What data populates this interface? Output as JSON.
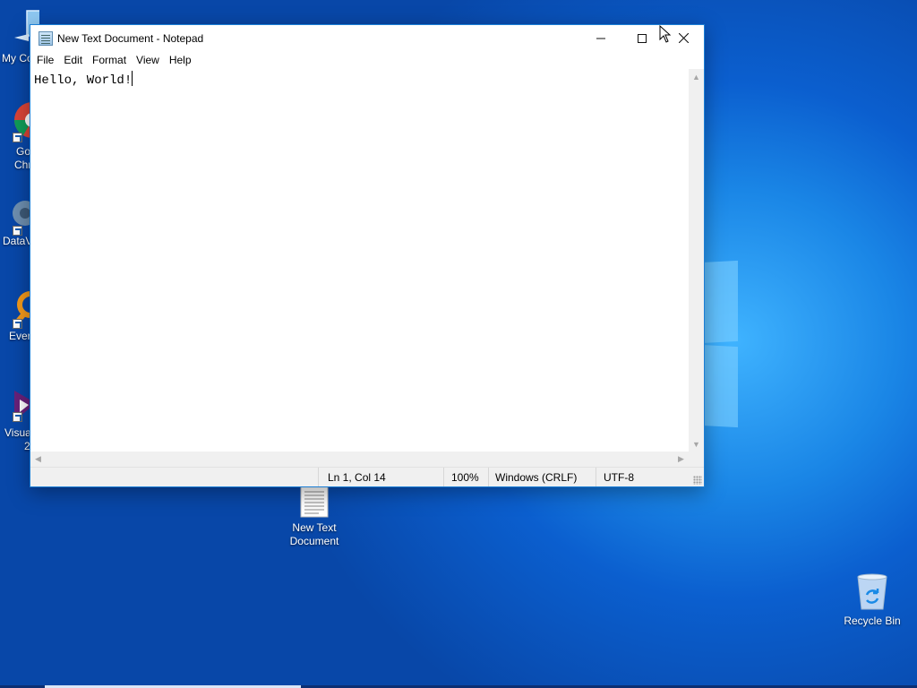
{
  "window": {
    "title": "New Text Document - Notepad",
    "menu": [
      "File",
      "Edit",
      "Format",
      "View",
      "Help"
    ],
    "content": "Hello, World!",
    "status": {
      "position": "Ln 1, Col 14",
      "zoom": "100%",
      "line_endings": "Windows (CRLF)",
      "encoding": "UTF-8"
    }
  },
  "desktop": {
    "left_icons": [
      {
        "label": "My Co",
        "label2": "",
        "icon": "computer-icon"
      },
      {
        "label": "Go",
        "label2": "Chr",
        "icon": "chrome-icon"
      },
      {
        "label": "DataV",
        "label2": "",
        "icon": "dataviz-icon"
      },
      {
        "label": "Ever",
        "label2": "",
        "icon": "everything-icon"
      },
      {
        "label": "Visua",
        "label2": "2",
        "icon": "visual-studio-icon"
      }
    ],
    "file_icon": {
      "line1": "New Text",
      "line2": "Document",
      "icon": "text-file-icon"
    },
    "recycle_bin": {
      "label": "Recycle Bin",
      "icon": "recycle-bin-icon"
    }
  },
  "colors": {
    "accent": "#1c7fd6",
    "desktop": "#0b63d6"
  }
}
